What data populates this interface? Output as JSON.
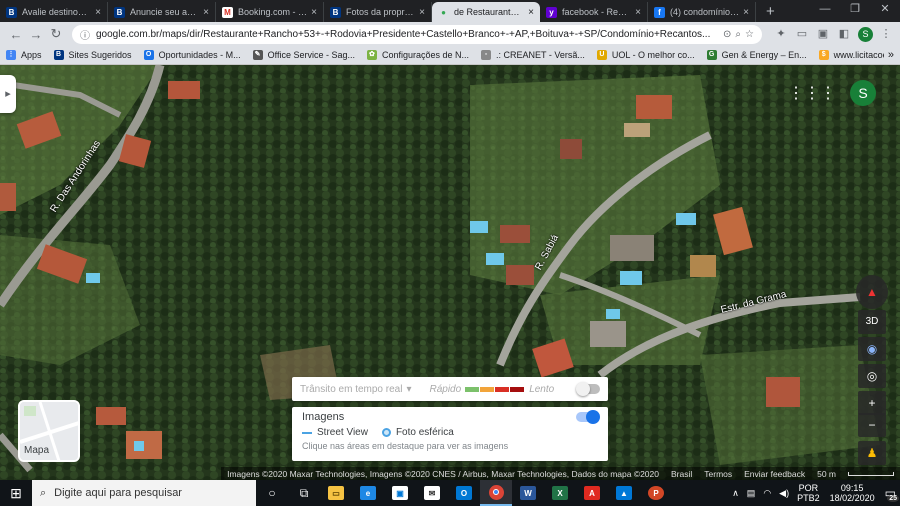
{
  "browser": {
    "tabs": [
      {
        "icon": "b-icon",
        "label": "Avalie destinos m",
        "color": "#003580",
        "glyph": "B",
        "active": false
      },
      {
        "icon": "b-icon",
        "label": "Anuncie seu apart",
        "color": "#003580",
        "glyph": "B",
        "active": false
      },
      {
        "icon": "gmail-icon",
        "label": "Booking.com - Bo",
        "color": "#ffffff",
        "glyph": "M",
        "active": false
      },
      {
        "icon": "b-icon",
        "label": "Fotos da propried",
        "color": "#003580",
        "glyph": "B",
        "active": false
      },
      {
        "icon": "maps-pin-icon",
        "label": "de Restaurante R",
        "color": "#34a853",
        "glyph": "●",
        "active": true
      },
      {
        "icon": "yahoo-icon",
        "label": "facebook - Result",
        "color": "#6001d2",
        "glyph": "y",
        "active": false
      },
      {
        "icon": "facebook-icon",
        "label": "(4) condomínio m",
        "color": "#1877f2",
        "glyph": "f",
        "active": false
      }
    ],
    "new_tab": "+",
    "window_controls": {
      "minimize": "—",
      "maximize": "❐",
      "close": "✕"
    },
    "url": "google.com.br/maps/dir/Restaurante+Rancho+53+-+Rodovia+Presidente+Castello+Branco+-+AP,+Boituva+-+SP/Condomínio+Recantos...",
    "profile_initial": "S",
    "bookmarks": [
      {
        "label": "Apps",
        "icon": "apps-grid-icon",
        "color": "#4285f4",
        "glyph": "⋮"
      },
      {
        "label": "Sites Sugeridos",
        "icon": "b-icon",
        "color": "#003580",
        "glyph": "B"
      },
      {
        "label": "Oportunidades - M...",
        "icon": "opportunity-icon",
        "color": "#1a73e8",
        "glyph": "O"
      },
      {
        "label": "Office Service - Sag...",
        "icon": "office-icon",
        "color": "#555555",
        "glyph": "✎"
      },
      {
        "label": "Configurações de N...",
        "icon": "config-icon",
        "color": "#7cb342",
        "glyph": "✿"
      },
      {
        "label": ".: CREANET - Versã...",
        "icon": "page-icon",
        "color": "#888888",
        "glyph": "▫"
      },
      {
        "label": "UOL - O melhor co...",
        "icon": "uol-icon",
        "color": "#e0a800",
        "glyph": "U"
      },
      {
        "label": "Gen & Energy – En...",
        "icon": "gen-icon",
        "color": "#2e7d32",
        "glyph": "G"
      },
      {
        "label": "www.licitacoes-e.co...",
        "icon": "licitacoes-icon",
        "color": "#f9a825",
        "glyph": "$"
      }
    ],
    "bookmarks_more": "»"
  },
  "map": {
    "road_labels": {
      "andorinhas": "R. Das Andorinhas",
      "sabia": "R. Sabiá",
      "grama": "Estr. da Grama"
    },
    "account_initial": "S",
    "controls": {
      "compass": "▲",
      "mode_3d": "3D",
      "globe": "◉",
      "locate": "◎",
      "zoom_in": "+",
      "zoom_out": "−",
      "pegman": "♟"
    },
    "traffic": {
      "label": "Trânsito em tempo real",
      "fast": "Rápido",
      "slow": "Lento",
      "colors": [
        "#7cc16b",
        "#f2a43a",
        "#d93025",
        "#a50e0e"
      ]
    },
    "imagery": {
      "title": "Imagens",
      "street_view": "Street View",
      "photo_sphere": "Foto esférica",
      "hint": "Clique nas áreas em destaque para ver as imagens",
      "enabled": true
    },
    "mapa_toggle": "Mapa",
    "attribution": {
      "credits": "Imagens ©2020 Maxar Technologies, Imagens ©2020 CNES / Airbus, Maxar Technologies, Dados do mapa ©2020",
      "country": "Brasil",
      "terms": "Termos",
      "feedback": "Enviar feedback",
      "scale": "50 m"
    }
  },
  "taskbar": {
    "search_placeholder": "Digite aqui para pesquisar",
    "language": "POR",
    "layout": "PTB2",
    "time": "09:15",
    "date": "18/02/2020",
    "notifications": "25"
  }
}
